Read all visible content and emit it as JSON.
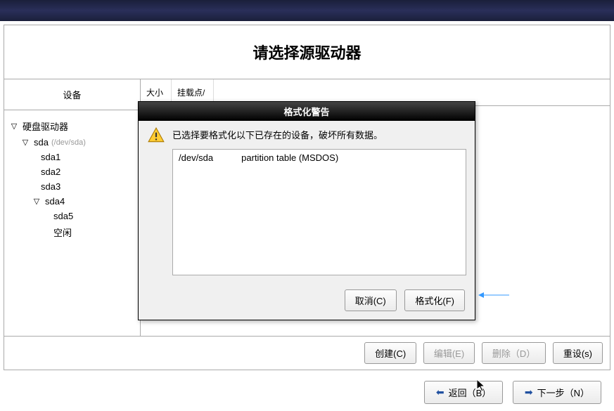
{
  "page_title": "请选择源驱动器",
  "tree": {
    "header": "设备",
    "root": "硬盘驱动器",
    "sda": {
      "label": "sda",
      "path": "(/dev/sda)"
    },
    "children": [
      "sda1",
      "sda2",
      "sda3"
    ],
    "sda4": "sda4",
    "sda4_children": [
      "sda5",
      "空闲"
    ]
  },
  "table_headers": {
    "size": "大小",
    "mount": "挂载点/"
  },
  "toolbar": {
    "create": "创建(C)",
    "edit": "编辑(E)",
    "delete": "删除（D）",
    "reset": "重设(s)"
  },
  "nav": {
    "back": "返回（B）",
    "next": "下一步（N）"
  },
  "dialog": {
    "title": "格式化警告",
    "message": "已选择要格式化以下已存在的设备，破坏所有数据。",
    "items": [
      {
        "device": "/dev/sda",
        "desc": "partition table (MSDOS)"
      }
    ],
    "cancel": "取消(C)",
    "format": "格式化(F)"
  }
}
